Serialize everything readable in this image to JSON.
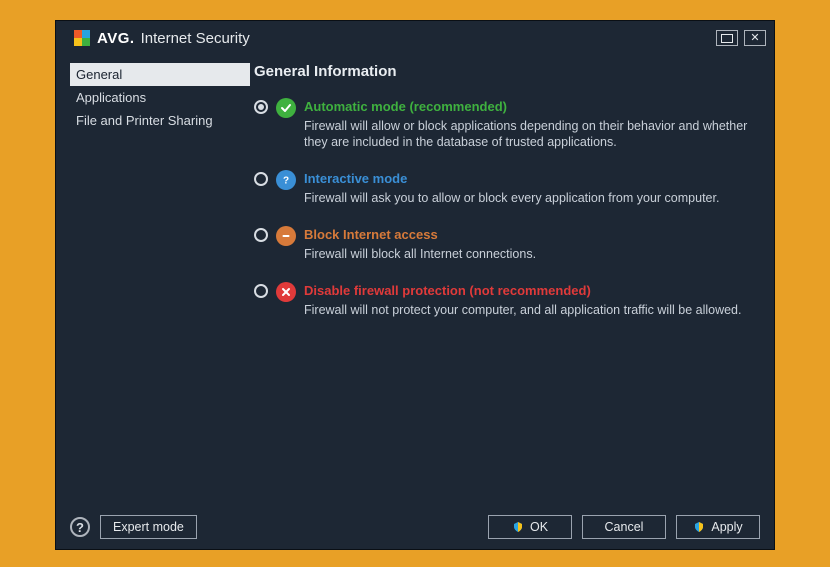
{
  "titlebar": {
    "brand": "AVG.",
    "product": "Internet Security"
  },
  "sidebar": {
    "items": [
      {
        "label": "General",
        "active": true
      },
      {
        "label": "Applications",
        "active": false
      },
      {
        "label": "File and Printer Sharing",
        "active": false
      }
    ]
  },
  "main": {
    "heading": "General Information",
    "options": [
      {
        "id": "automatic",
        "selected": true,
        "title": "Automatic mode (recommended)",
        "desc": "Firewall will allow or block applications depending on their behavior and whether they are included in the database of trusted applications.",
        "color_class": "t-green",
        "badge_bg": "#3fb13f",
        "badge_glyph": "check"
      },
      {
        "id": "interactive",
        "selected": false,
        "title": "Interactive mode",
        "desc": "Firewall will ask you to allow or block every application from your computer.",
        "color_class": "t-blue",
        "badge_bg": "#3a8fd6",
        "badge_glyph": "question"
      },
      {
        "id": "block",
        "selected": false,
        "title": "Block Internet access",
        "desc": "Firewall will block all Internet connections.",
        "color_class": "t-orange",
        "badge_bg": "#d77a3a",
        "badge_glyph": "minus"
      },
      {
        "id": "disable",
        "selected": false,
        "title": "Disable firewall protection (not recommended)",
        "desc": "Firewall will not protect your computer, and all application traffic will be allowed.",
        "color_class": "t-red",
        "badge_bg": "#e03a3a",
        "badge_glyph": "cross"
      }
    ]
  },
  "footer": {
    "expert_mode": "Expert mode",
    "ok": "OK",
    "cancel": "Cancel",
    "apply": "Apply"
  }
}
